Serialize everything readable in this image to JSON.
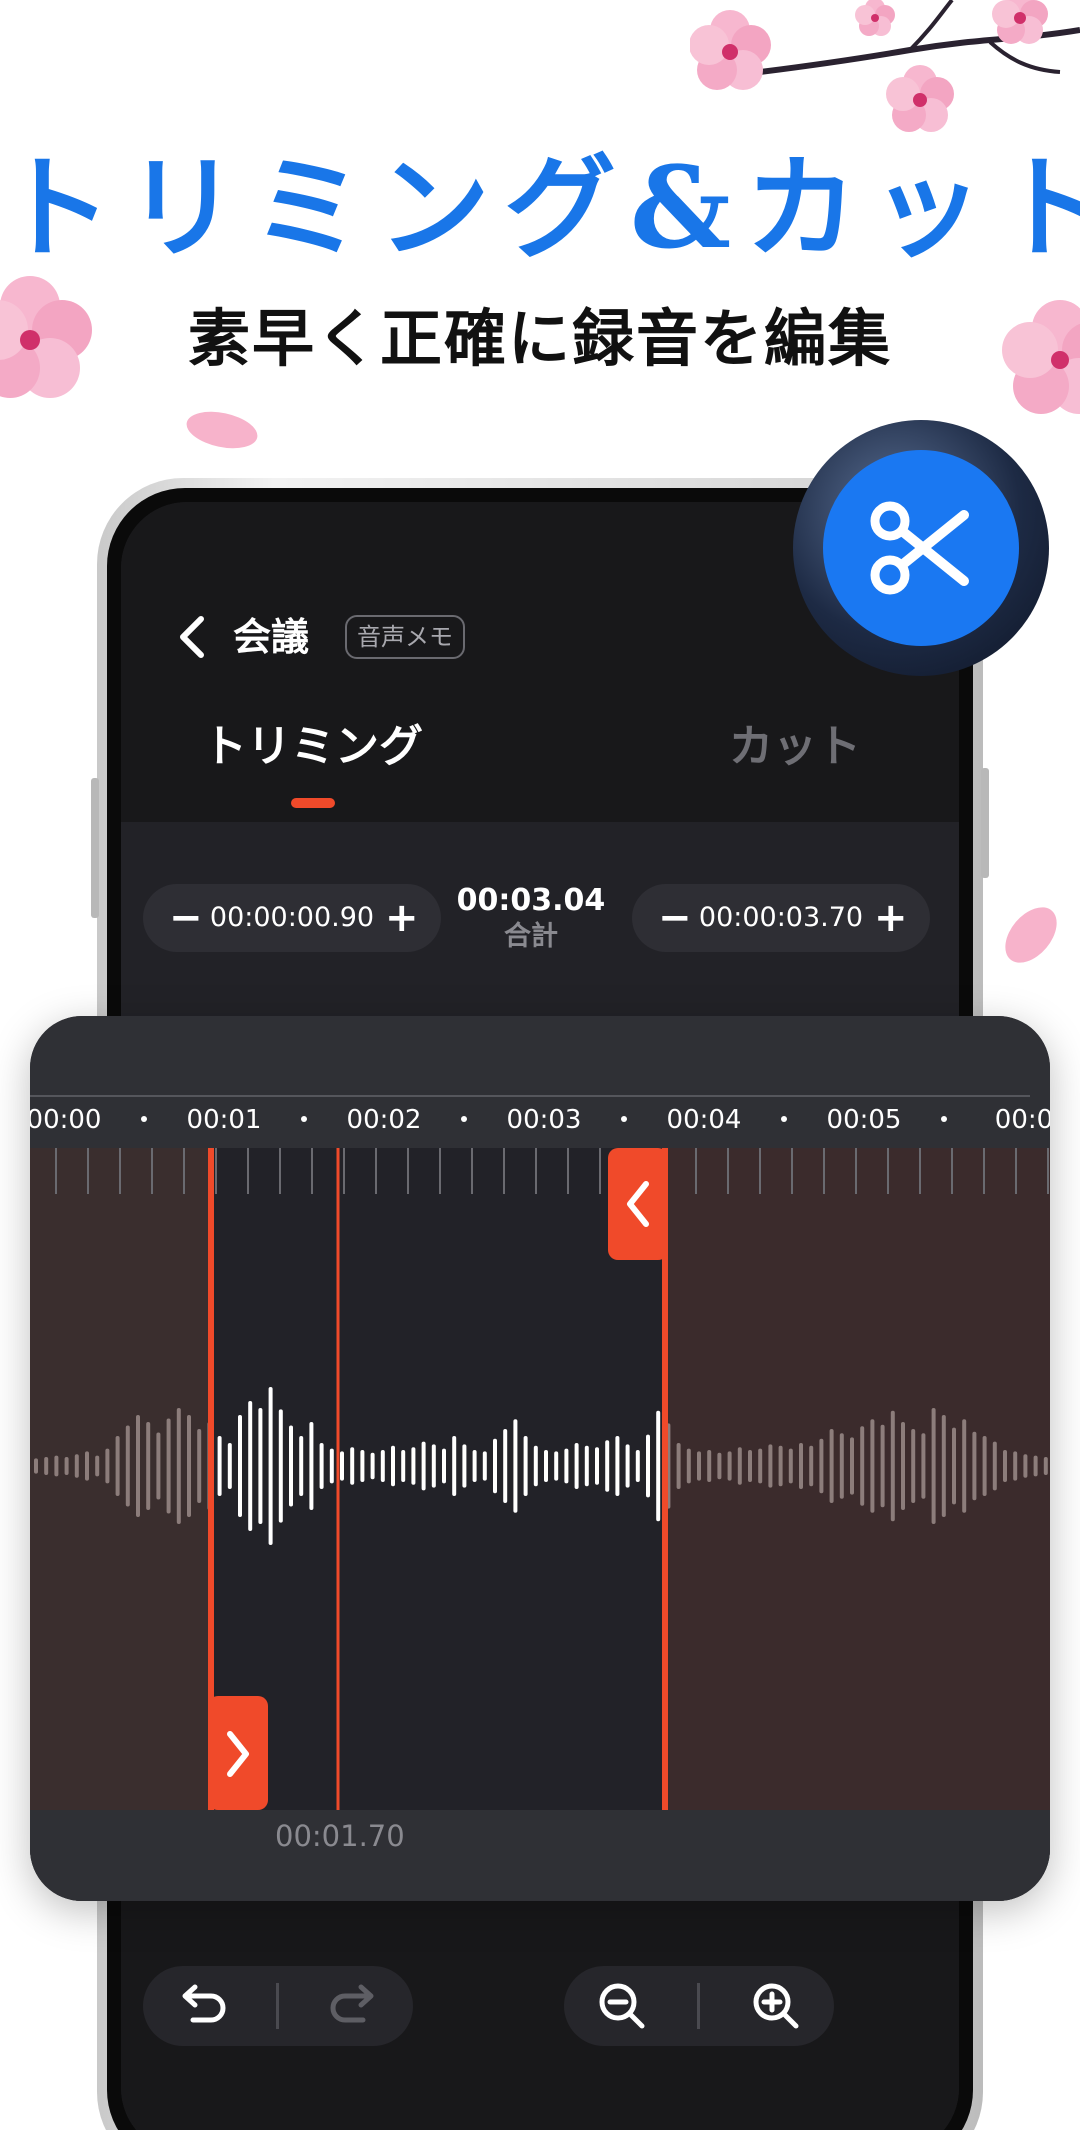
{
  "promo": {
    "headline": "トリミング&カット",
    "subheadline": "素早く正確に録音を編集"
  },
  "app": {
    "recording_title": "会議",
    "recording_badge": "音声メモ",
    "tabs": [
      {
        "label": "トリミング",
        "active": true
      },
      {
        "label": "カット",
        "active": false
      }
    ],
    "start_time": {
      "minus": "−",
      "value": "00:00:00.90",
      "plus": "+"
    },
    "end_time": {
      "minus": "−",
      "value": "00:00:03.70",
      "plus": "+"
    },
    "total": {
      "value": "00:03.04",
      "label": "合計"
    },
    "timeline": {
      "ticks": [
        "00:00",
        "00:01",
        "00:02",
        "00:03",
        "00:04",
        "00:05",
        "00:0"
      ],
      "playhead_time": "00:01.70"
    },
    "controls": {
      "undo_icon": "undo-icon",
      "redo_icon": "redo-icon",
      "zoom_out_icon": "zoom-out-icon",
      "zoom_in_icon": "zoom-in-icon"
    }
  },
  "colors": {
    "accent": "#f04a2a",
    "headline": "#1976e8",
    "scissors_badge": "#1a78f2"
  }
}
